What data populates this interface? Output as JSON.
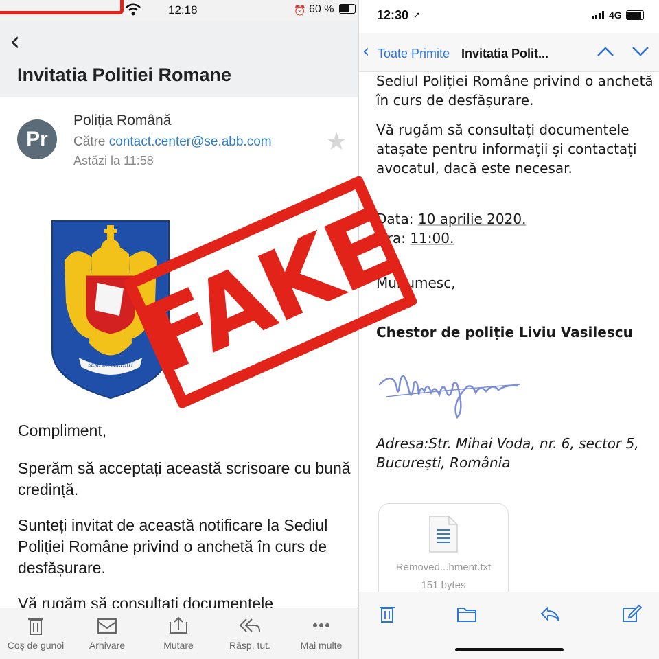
{
  "left": {
    "status": {
      "time": "12:18",
      "battery": "60 %"
    },
    "header": {
      "title": "Invitatia Politiei Romane"
    },
    "email": {
      "avatar": "Pr",
      "sender": "Poliția Română",
      "to_label": "Către",
      "to_email": "contact.center@se.abb.com",
      "date": "Astăzi la 11:58"
    },
    "crest_motto": "SEMPER VERITATI",
    "body": {
      "greeting": "Compliment,",
      "p1": "Sperăm să acceptați această scrisoare cu bună credință.",
      "p2": "Sunteți invitat de această notificare la Sediul Poliției Române privind o anchetă în curs de desfășurare.",
      "p3": "Vă rugăm să consultați documentele"
    },
    "toolbar": [
      {
        "label": "Coș de gunoi",
        "icon": "trash-icon"
      },
      {
        "label": "Arhivare",
        "icon": "archive-icon"
      },
      {
        "label": "Mutare",
        "icon": "move-icon"
      },
      {
        "label": "Răsp. tut.",
        "icon": "reply-all-icon"
      },
      {
        "label": "Mai multe",
        "icon": "more-icon"
      }
    ]
  },
  "stamp": {
    "text": "FAKE",
    "color": "#e2231a"
  },
  "right": {
    "status": {
      "time": "12:30",
      "network": "4G"
    },
    "nav": {
      "back_label": "Toate Primite",
      "subject": "Invitatia Polit..."
    },
    "body": {
      "p1": "Sediul Poliției Române privind o anchetă în curs de desfășurare.",
      "p2": "Vă rugăm să consultați documentele atașate pentru informații și contactați avocatul, dacă este necesar.",
      "date_label": "Data:",
      "date_value": "10 aprilie 2020.",
      "time_label": "Ora:",
      "time_value": "11:00.",
      "thanks": "Mulțumesc,",
      "signatory": "Chestor de poliție Liviu Vasilescu",
      "address": "Adresa:Str. Mihai Voda, nr. 6, sector 5, Bucureşti, România"
    },
    "attachment": {
      "name": "Removed...hment.txt",
      "size": "151 bytes"
    },
    "toolbar_icons": [
      "trash-icon",
      "folder-icon",
      "reply-icon",
      "compose-icon"
    ],
    "accent": "#2f74d8"
  }
}
